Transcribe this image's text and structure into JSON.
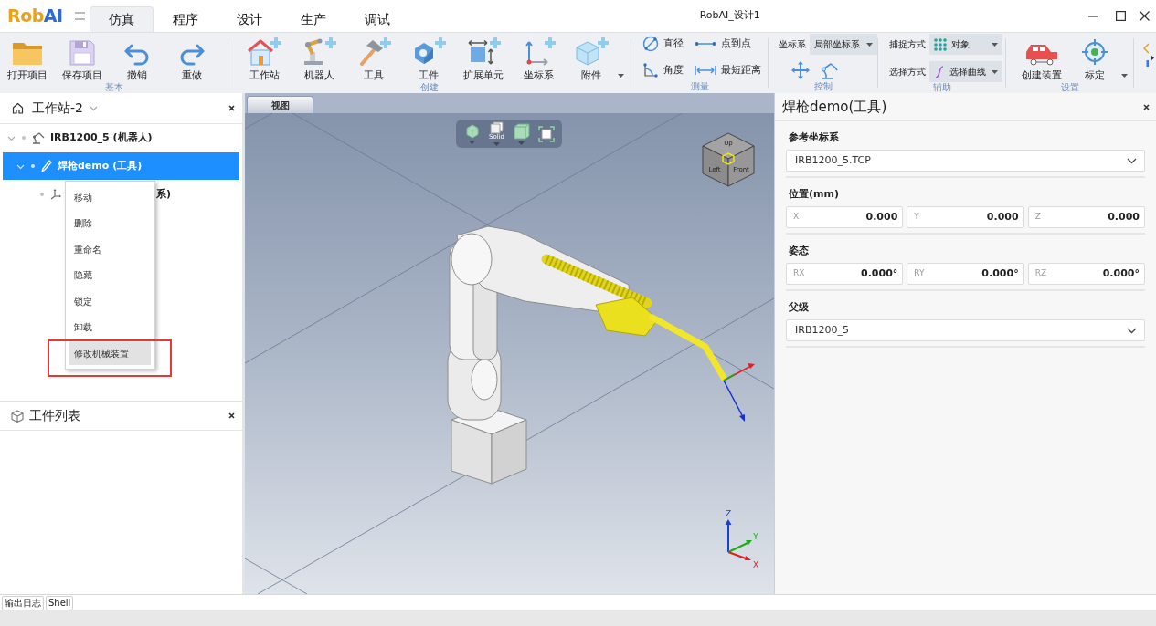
{
  "window": {
    "title": "RobAI_设计1"
  },
  "logo": {
    "parts": [
      {
        "text": "Rob",
        "color": "#e8a21c"
      },
      {
        "text": "AI",
        "color": "#2f6cd0"
      }
    ]
  },
  "menu_tabs": [
    {
      "label": "仿真",
      "selected": true
    },
    {
      "label": "程序",
      "selected": false
    },
    {
      "label": "设计",
      "selected": false
    },
    {
      "label": "生产",
      "selected": false
    },
    {
      "label": "调试",
      "selected": false
    }
  ],
  "ribbon": {
    "groups": [
      {
        "label": "基本",
        "items": [
          {
            "kind": "large",
            "label": "打开项目"
          },
          {
            "kind": "large",
            "label": "保存项目"
          },
          {
            "kind": "large",
            "label": "撤销"
          },
          {
            "kind": "large",
            "label": "重做"
          }
        ]
      },
      {
        "label": "创建",
        "items": [
          {
            "kind": "large",
            "label": "工作站"
          },
          {
            "kind": "large",
            "label": "机器人"
          },
          {
            "kind": "large",
            "label": "工具"
          },
          {
            "kind": "large",
            "label": "工件"
          },
          {
            "kind": "large",
            "label": "扩展单元"
          },
          {
            "kind": "large",
            "label": "坐标系"
          },
          {
            "kind": "large_menu",
            "label": "附件"
          }
        ]
      },
      {
        "label": "测量",
        "items": [
          {
            "kind": "small",
            "label": "直径"
          },
          {
            "kind": "small",
            "label": "点到点"
          },
          {
            "kind": "small",
            "label": "角度"
          },
          {
            "kind": "small",
            "label": "最短距离"
          }
        ]
      },
      {
        "label": "控制",
        "items": [
          {
            "kind": "combo",
            "label": "坐标系",
            "value": "局部坐标系"
          },
          {
            "kind": "icon"
          },
          {
            "kind": "icon"
          }
        ]
      },
      {
        "label": "辅助",
        "items": [
          {
            "kind": "combo",
            "label": "捕捉方式",
            "value": "对象"
          },
          {
            "kind": "combo",
            "label": "选择方式",
            "value": "选择曲线"
          }
        ]
      },
      {
        "label": "设置",
        "items": [
          {
            "kind": "large",
            "label": "创建装置"
          },
          {
            "kind": "large_menu",
            "label": "标定"
          }
        ]
      }
    ]
  },
  "station_panel": {
    "title": "工作站-2",
    "tree": [
      {
        "kind": "robot",
        "label": "IRB1200_5 (机器人)",
        "expanded": true,
        "selected": false,
        "children": [
          {
            "kind": "tool",
            "label": "焊枪demo (工具)",
            "expanded": true,
            "selected": true,
            "children": [
              {
                "kind": "frame",
                "label": "系)",
                "selected": false
              }
            ]
          }
        ]
      }
    ]
  },
  "context_menu": {
    "items": [
      {
        "label": "移动",
        "selected": false,
        "highlighted": false
      },
      {
        "label": "删除",
        "selected": false,
        "highlighted": false
      },
      {
        "label": "重命名",
        "selected": false,
        "highlighted": false
      },
      {
        "label": "隐藏",
        "selected": false,
        "highlighted": false
      },
      {
        "label": "锁定",
        "selected": false,
        "highlighted": false
      },
      {
        "label": "卸载",
        "selected": false,
        "highlighted": false
      },
      {
        "label": "修改机械装置",
        "selected": true,
        "highlighted": true
      }
    ]
  },
  "workpiece_panel": {
    "title": "工件列表"
  },
  "viewport": {
    "tab": "视图",
    "view_toolbar": [
      {
        "kind": "shaded",
        "dropdown": true
      },
      {
        "kind": "solid",
        "label": "Solid",
        "dropdown": true
      },
      {
        "kind": "box",
        "dropdown": true
      },
      {
        "kind": "fit",
        "dropdown": false
      }
    ],
    "view_cube": {
      "faces": [
        "Up",
        "Left",
        "Front"
      ]
    },
    "axis_triad": {
      "labels": [
        {
          "text": "Z",
          "color": "#1a3fd8"
        },
        {
          "text": "Y",
          "color": "#16b016"
        },
        {
          "text": "X",
          "color": "#e02020"
        }
      ]
    }
  },
  "properties_panel": {
    "title": "焊枪demo(工具)",
    "sections": [
      {
        "kind": "select",
        "label": "参考坐标系",
        "value": "IRB1200_5.TCP"
      },
      {
        "kind": "fields",
        "label": "位置(mm)",
        "fields": [
          {
            "label": "X",
            "value": "0.000"
          },
          {
            "label": "Y",
            "value": "0.000"
          },
          {
            "label": "Z",
            "value": "0.000"
          }
        ]
      },
      {
        "kind": "fields",
        "label": "姿态",
        "fields": [
          {
            "label": "RX",
            "value": "0.000°"
          },
          {
            "label": "RY",
            "value": "0.000°"
          },
          {
            "label": "RZ",
            "value": "0.000°"
          }
        ]
      },
      {
        "kind": "select",
        "label": "父级",
        "value": "IRB1200_5"
      }
    ]
  },
  "bottom_tabs": [
    {
      "label": "输出日志"
    },
    {
      "label": "Shell"
    }
  ]
}
